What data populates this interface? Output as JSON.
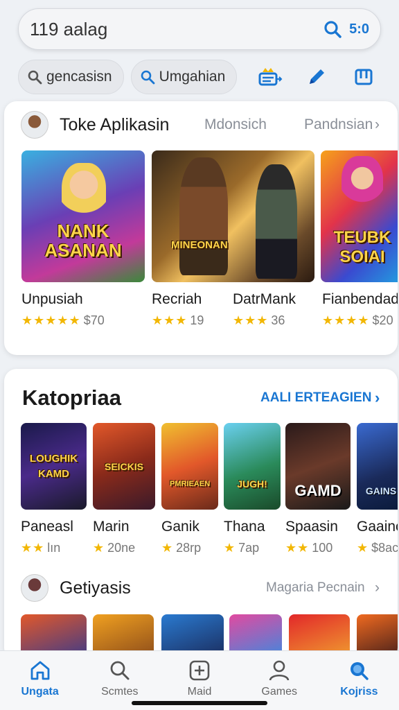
{
  "search": {
    "query": "119 aalag",
    "time": "5:0"
  },
  "chips": [
    {
      "label": "gencasisn"
    },
    {
      "label": "Umgahian"
    }
  ],
  "top_apps": {
    "title": "Toke Aplikasin",
    "link1": "Mdonsich",
    "link2": "Pandnsian",
    "items": [
      {
        "art": "NANK ASANAN",
        "name": "Unpusiah",
        "stars": "★★★★★",
        "rating": "$70"
      },
      {
        "art": "MINEONAN",
        "name": "Recriah",
        "stars": "★★★",
        "rating": "19"
      },
      {
        "art": "",
        "name": "DatrMank",
        "stars": "★★★",
        "rating": "36"
      },
      {
        "art": "TEUBK SOIAI",
        "name": "Fianbendado",
        "stars": "★★★★",
        "rating": "$20"
      }
    ]
  },
  "categories": {
    "title": "Katopriaa",
    "link": "AALI ERTEAGIEN",
    "items": [
      {
        "art": "LOUGHIK KAMD",
        "name": "Paneasl",
        "stars": "★★",
        "rating": "lın"
      },
      {
        "art": "SEICKIS",
        "name": "Marin",
        "stars": "★",
        "rating": "20ne"
      },
      {
        "art": "PMRIEAEN",
        "name": "Ganik",
        "stars": "★",
        "rating": "28rp"
      },
      {
        "art": "JUGH!",
        "name": "Thana",
        "stars": "★",
        "rating": "7ap"
      },
      {
        "art": "GAMD",
        "name": "Spaasin",
        "stars": "★★",
        "rating": "100"
      },
      {
        "art": "GAINS",
        "name": "Gaainc",
        "stars": "★",
        "rating": "$8ac"
      }
    ]
  },
  "getiyasis": {
    "title": "Getiyasis",
    "link": "Magaria Pecnain"
  },
  "nav": [
    {
      "label": "Ungata",
      "icon": "home-icon",
      "active": true
    },
    {
      "label": "Scmtes",
      "icon": "search-icon",
      "active": false
    },
    {
      "label": "Maid",
      "icon": "add-icon",
      "active": false
    },
    {
      "label": "Games",
      "icon": "person-icon",
      "active": false
    },
    {
      "label": "Kojriss",
      "icon": "search-filled-icon",
      "active": true
    }
  ]
}
